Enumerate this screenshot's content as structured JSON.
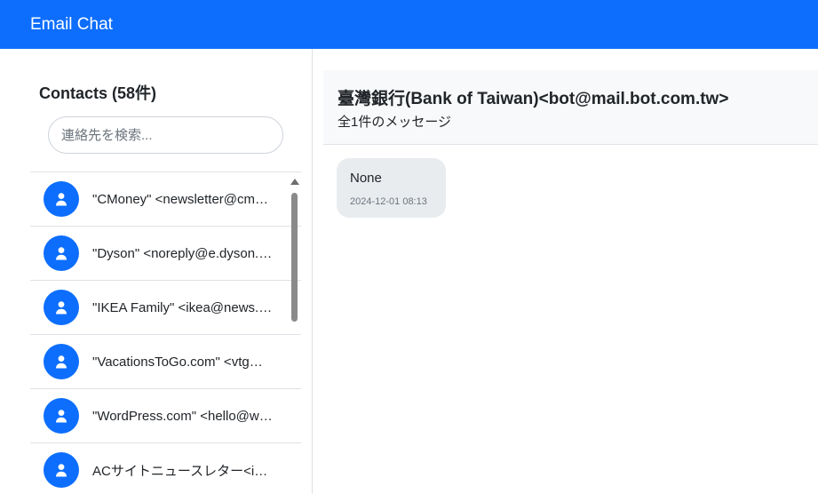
{
  "navbar": {
    "brand": "Email Chat"
  },
  "sidebar": {
    "title": "Contacts (58件)",
    "search_placeholder": "連絡先を検索...",
    "contacts": [
      {
        "name": "\"CMoney\" <newsletter@cmoney.tw>"
      },
      {
        "name": "\"Dyson\" <noreply@e.dyson.com>"
      },
      {
        "name": "\"IKEA Family\" <ikea@news.ikea.com.tw>"
      },
      {
        "name": "\"VacationsToGo.com\" <vtg@vacationstogo.com>"
      },
      {
        "name": "\"WordPress.com\" <hello@wordpress.com>"
      },
      {
        "name": "ACサイトニュースレター<info@freebie-ac.jp>"
      }
    ]
  },
  "chat": {
    "title": "臺灣銀行(Bank of Taiwan)<bot@mail.bot.com.tw>",
    "subtitle": "全1件のメッセージ",
    "messages": [
      {
        "text": "None",
        "timestamp": "2024-12-01 08:13"
      }
    ]
  },
  "icons": {
    "avatar": "user-icon",
    "scroll_up": "triangle-up-icon"
  },
  "colors": {
    "primary": "#0d6efd",
    "bubble": "#e9ecef",
    "header_bg": "#f8f9fa"
  }
}
